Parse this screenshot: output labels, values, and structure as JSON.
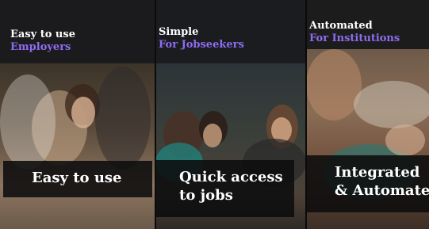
{
  "panels": [
    {
      "title": "Easy to use",
      "subtitle": "Employers",
      "caption_lines": [
        "Easy to use"
      ]
    },
    {
      "title": "Simple",
      "subtitle": "For Jobseekers",
      "caption_lines": [
        "Quick access",
        "to jobs"
      ]
    },
    {
      "title": "Automated",
      "subtitle": "For Institutions",
      "caption_lines": [
        "Integrated",
        "& Automated"
      ]
    }
  ],
  "colors": {
    "accent": "#8d6cf0",
    "header_text": "#ffffff",
    "caption_bg": "#0c0c0e"
  }
}
